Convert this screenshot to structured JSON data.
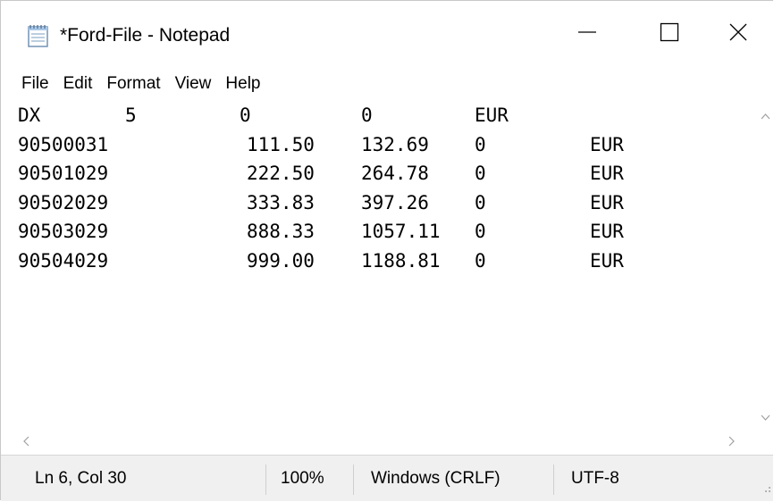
{
  "window": {
    "title": "*Ford-File - Notepad"
  },
  "menu": {
    "items": [
      "File",
      "Edit",
      "Format",
      "View",
      "Help"
    ]
  },
  "editor": {
    "header": {
      "c1": "DX",
      "c2": "5",
      "c3": "0",
      "c4": "0",
      "c5": "EUR"
    },
    "rows": [
      {
        "c1": "90500031",
        "c2": "111.50",
        "c3": "132.69",
        "c4": "0",
        "c5": "EUR"
      },
      {
        "c1": "90501029",
        "c2": "222.50",
        "c3": "264.78",
        "c4": "0",
        "c5": "EUR"
      },
      {
        "c1": "90502029",
        "c2": "333.83",
        "c3": "397.26",
        "c4": "0",
        "c5": "EUR"
      },
      {
        "c1": "90503029",
        "c2": "888.33",
        "c3": "1057.11",
        "c4": "0",
        "c5": "EUR"
      },
      {
        "c1": "90504029",
        "c2": "999.00",
        "c3": "1188.81",
        "c4": "0",
        "c5": "EUR"
      }
    ]
  },
  "status": {
    "position": "Ln 6, Col 30",
    "zoom": "100%",
    "line_ending": "Windows (CRLF)",
    "encoding": "UTF-8"
  },
  "icons": {
    "app": "notepad-icon",
    "minimize": "minimize-icon",
    "maximize": "maximize-icon",
    "close": "close-icon"
  },
  "colors": {
    "background": "#ffffff",
    "statusbar": "#f0f0f0",
    "text": "#000000",
    "scroll_arrow": "#a0a0a0"
  }
}
